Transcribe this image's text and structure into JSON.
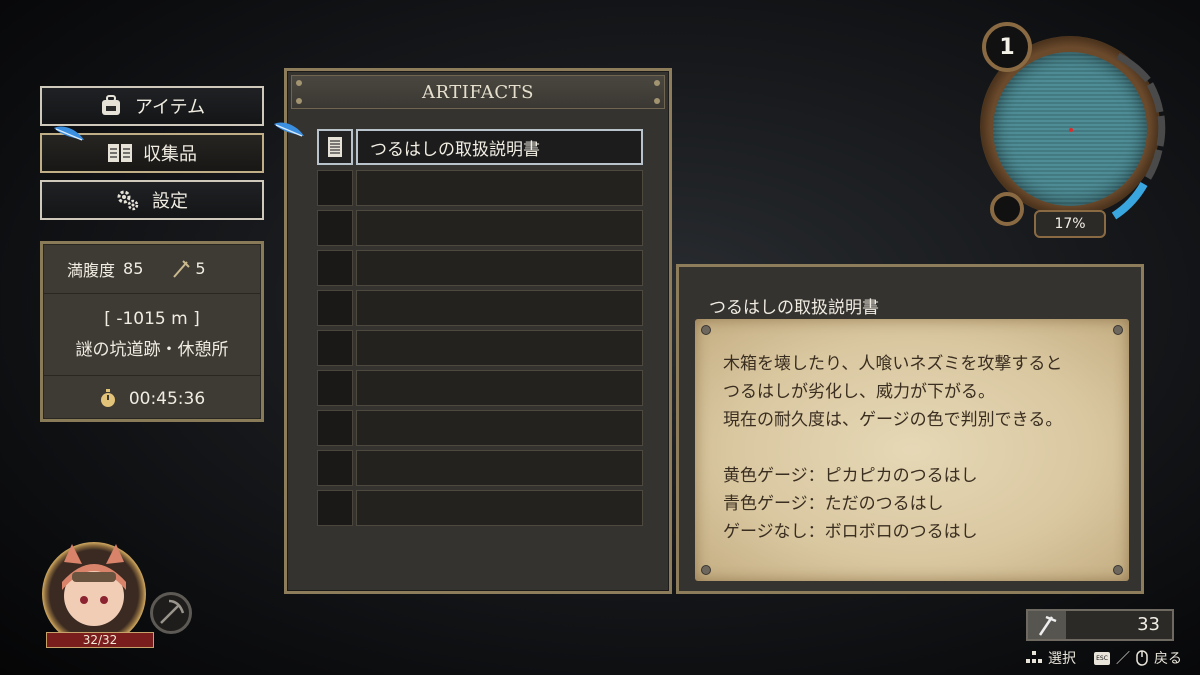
{
  "menu": {
    "items": [
      {
        "label": "アイテム",
        "icon": "backpack-icon"
      },
      {
        "label": "収集品",
        "icon": "book-icon",
        "selected": true
      },
      {
        "label": "設定",
        "icon": "gears-icon"
      }
    ]
  },
  "status": {
    "hunger_label": "満腹度",
    "hunger_value": "85",
    "pickaxe_count": "5",
    "depth": "[ -1015 m ]",
    "location": "謎の坑道跡・休憩所",
    "time": "00:45:36"
  },
  "artifacts": {
    "title": "ARTIFACTS",
    "slots": [
      {
        "name": "つるはしの取扱説明書",
        "selected": true
      },
      {
        "name": ""
      },
      {
        "name": ""
      },
      {
        "name": ""
      },
      {
        "name": ""
      },
      {
        "name": ""
      },
      {
        "name": ""
      },
      {
        "name": ""
      },
      {
        "name": ""
      },
      {
        "name": ""
      }
    ]
  },
  "description": {
    "title": "つるはしの取扱説明書",
    "lines": [
      "木箱を壊したり、人喰いネズミを攻撃すると",
      "つるはしが劣化し、威力が下がる。",
      "現在の耐久度は、ゲージの色で判別できる。",
      "",
      "黄色ゲージ：ピカピカのつるはし",
      "青色ゲージ：ただのつるはし",
      "ゲージなし：ボロボロのつるはし"
    ]
  },
  "minimap": {
    "floor": "1",
    "explored": "17%"
  },
  "player": {
    "hp": "32/32"
  },
  "inventory": {
    "pickaxe_stock": "33"
  },
  "hints": {
    "select": "選択",
    "separator": "／",
    "back": "戻る"
  },
  "colors": {
    "frame": "#8d7d5a",
    "parchment": "#e0d0ab",
    "selection": "#b8c3cc",
    "minimap": "#4f8d96"
  }
}
